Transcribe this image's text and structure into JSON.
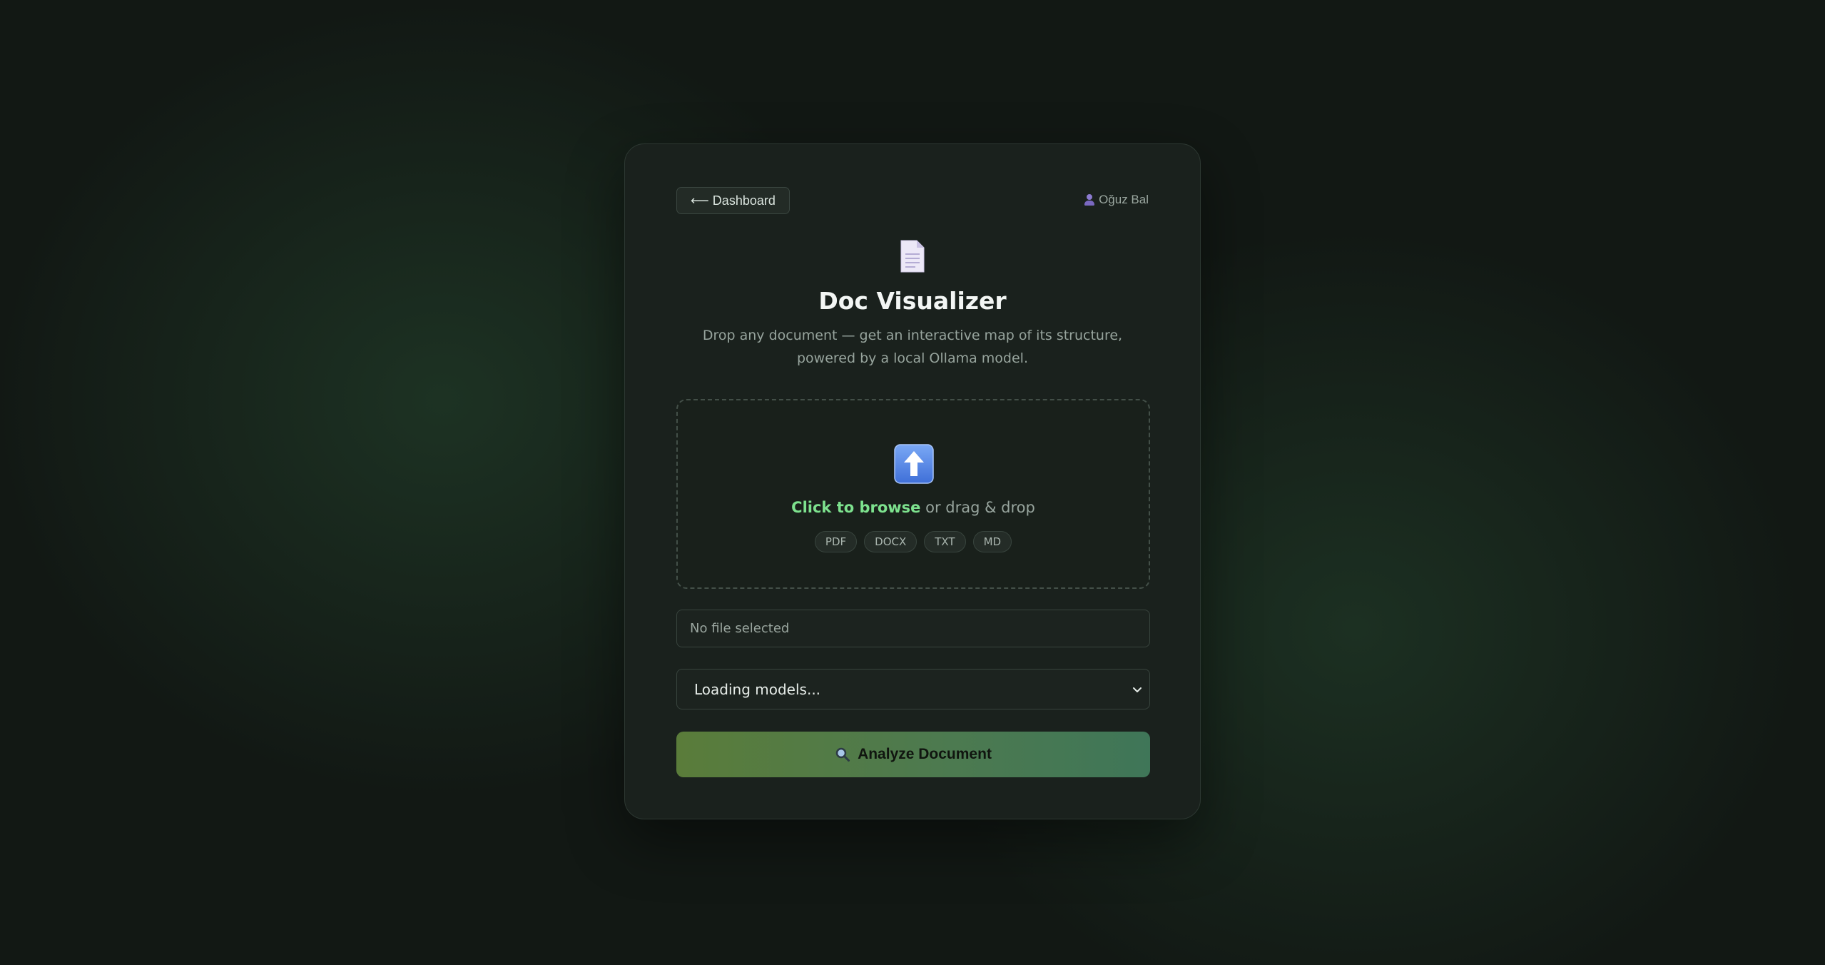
{
  "header": {
    "back_label": "⟵ Dashboard",
    "user_name": "Oğuz Bal"
  },
  "hero": {
    "title": "Doc Visualizer",
    "subtitle": "Drop any document — get an interactive map of its structure, powered by a local Ollama model."
  },
  "dropzone": {
    "browse_label": "Click to browse",
    "rest_label": " or drag & drop",
    "formats": [
      "PDF",
      "DOCX",
      "TXT",
      "MD"
    ]
  },
  "file": {
    "status": "No file selected"
  },
  "model": {
    "selected": "Loading models..."
  },
  "action": {
    "analyze_label": "Analyze Document"
  },
  "colors": {
    "accent_green": "#7de28e",
    "button_gradient_start": "#5a7c3a",
    "button_gradient_end": "#3f7658",
    "card_bg": "#1a211d",
    "page_bg": "#121814"
  },
  "icons": {
    "back": "arrow-left-icon",
    "user": "user-icon",
    "document": "document-icon",
    "upload": "upload-arrow-icon",
    "dropdown": "chevron-down-icon",
    "analyze": "magnifier-icon"
  }
}
